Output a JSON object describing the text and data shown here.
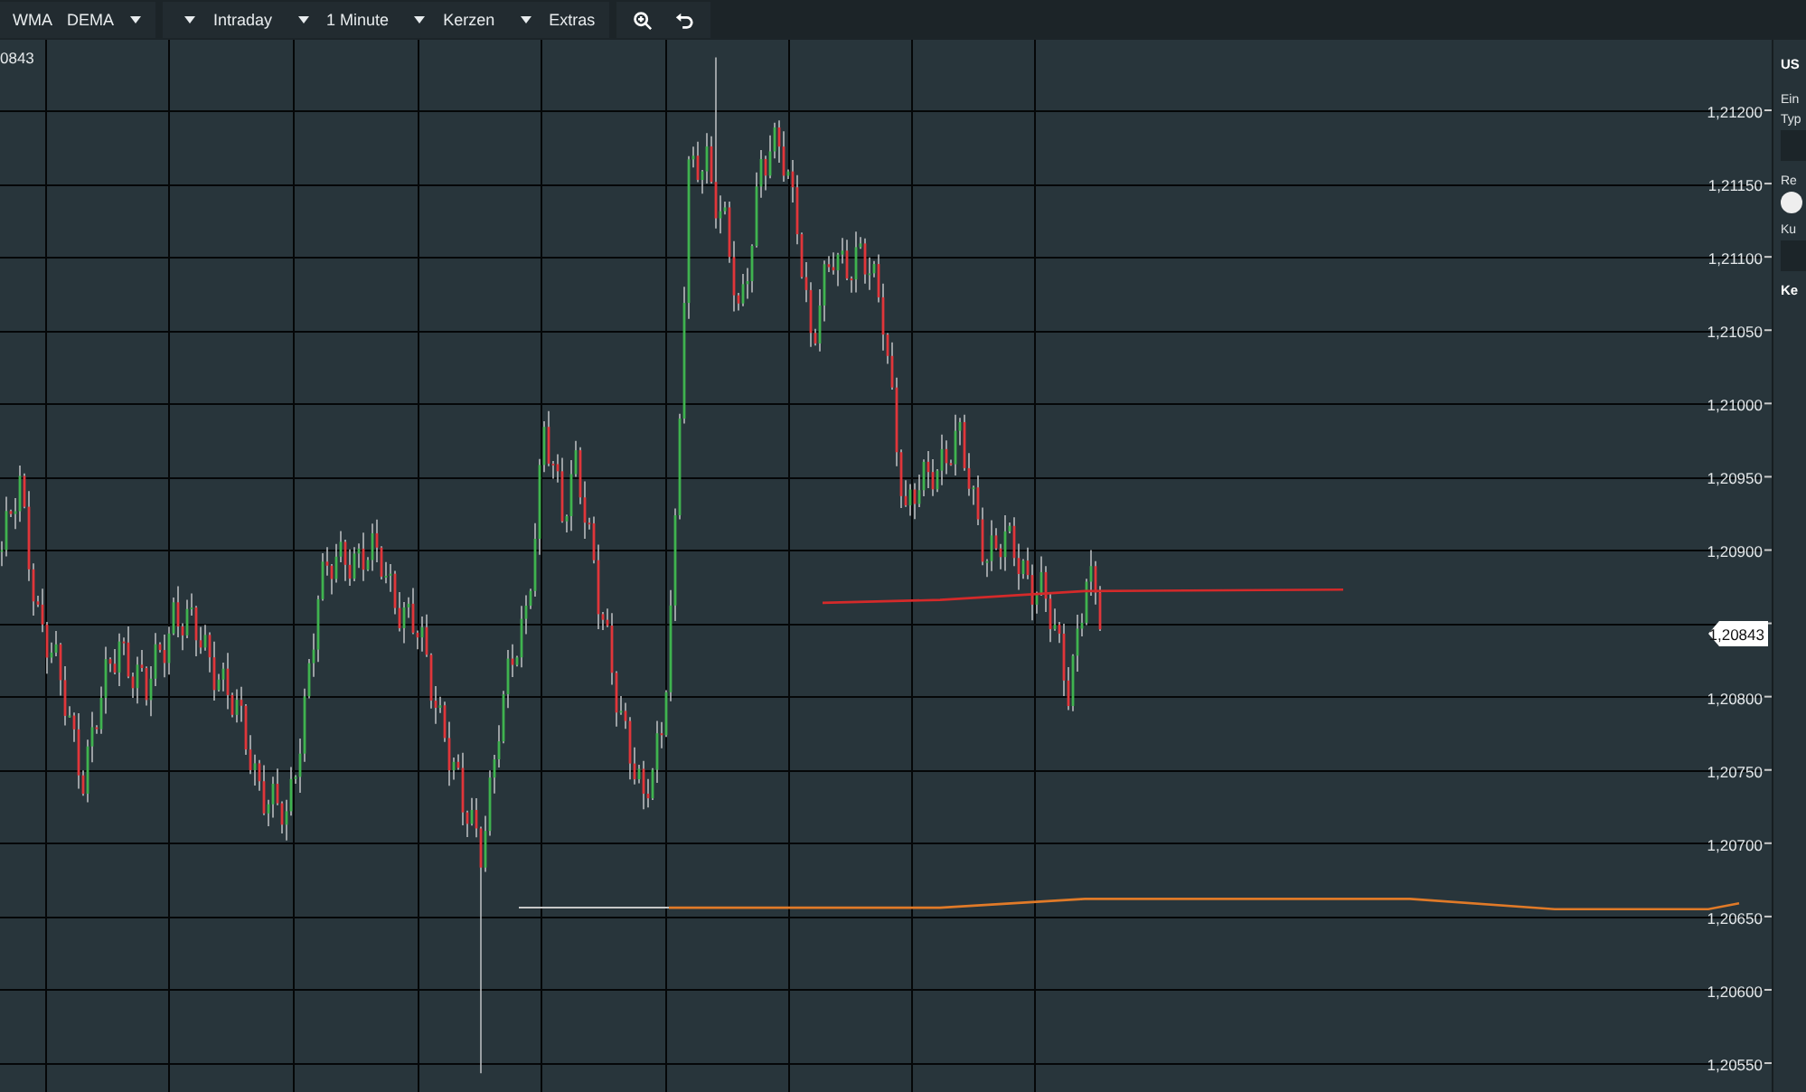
{
  "toolbar": {
    "indicators": {
      "items": [
        "WMA",
        "DEMA"
      ],
      "menu_caret": true
    },
    "dropdowns": [
      {
        "label": "Intraday"
      },
      {
        "label": "1 Minute"
      },
      {
        "label": "Kerzen"
      },
      {
        "label": "Extras"
      }
    ],
    "tools": [
      {
        "kind": "zoom"
      },
      {
        "kind": "undo"
      }
    ]
  },
  "chart": {
    "edge_label": "0843",
    "price_labels": [
      "1,21200",
      "1,21150",
      "1,21100",
      "1,21050",
      "1,21000",
      "1,20950",
      "1,20900",
      "1,20800",
      "1,20750",
      "1,20700",
      "1,20650",
      "1,20600",
      "1,20550"
    ],
    "last_price": "1,20843"
  },
  "side_panel": [
    {
      "kind": "heading",
      "text": "US"
    },
    {
      "kind": "label",
      "text": "Ein"
    },
    {
      "kind": "label",
      "text": "Typ"
    },
    {
      "kind": "field"
    },
    {
      "kind": "label",
      "text": "Re"
    },
    {
      "kind": "toggle",
      "on": false
    },
    {
      "kind": "label",
      "text": "Ku"
    },
    {
      "kind": "field"
    },
    {
      "kind": "heading",
      "text": "Ke"
    }
  ]
}
